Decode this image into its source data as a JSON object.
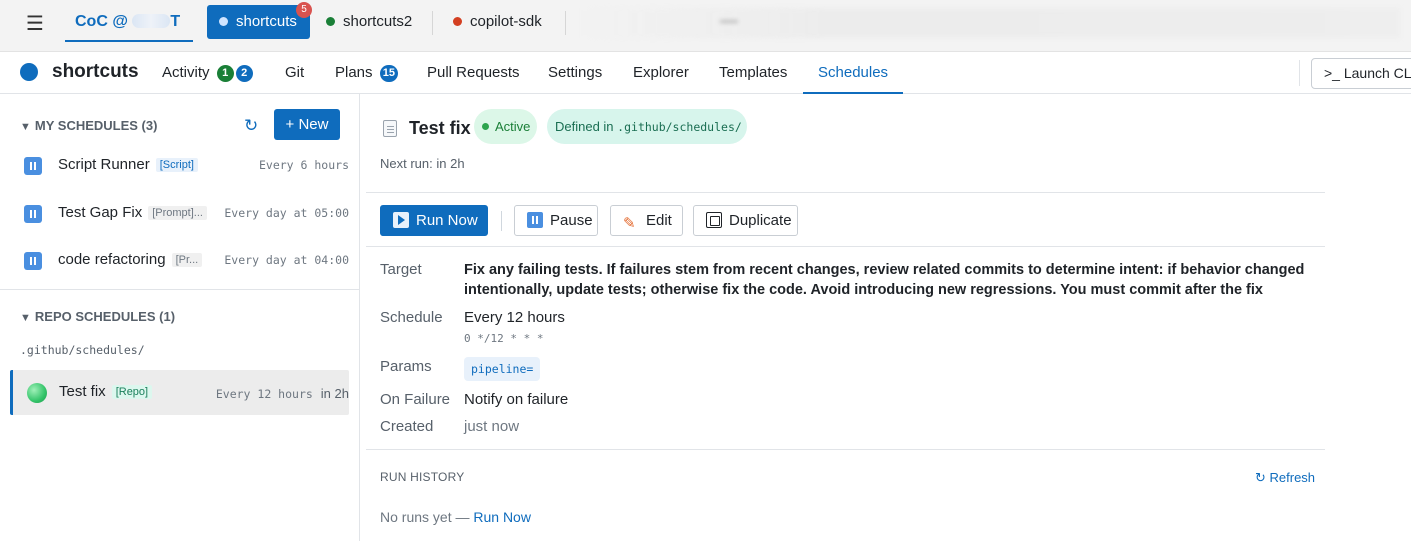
{
  "topbar": {
    "workspace_label": "CoC @",
    "workspace_suffix": "T",
    "tabs": [
      {
        "label": "shortcuts",
        "badge": "5",
        "dot_color": "#9ec9ff"
      },
      {
        "label": "shortcuts2",
        "dot_color": "#1a7f37"
      },
      {
        "label": "copilot-sdk",
        "dot_color": "#d33f21"
      }
    ]
  },
  "nav": {
    "repo_name": "shortcuts",
    "items": {
      "activity": "Activity",
      "activity_count_a": "1",
      "activity_count_b": "2",
      "git": "Git",
      "plans": "Plans",
      "plans_count": "15",
      "pull_requests": "Pull Requests",
      "settings": "Settings",
      "explorer": "Explorer",
      "templates": "Templates",
      "schedules": "Schedules"
    },
    "launch": ">_ Launch CLI"
  },
  "sidebar": {
    "my_schedules": "MY SCHEDULES (3)",
    "new_button": "+ New",
    "items": [
      {
        "name": "Script Runner",
        "tag": "[Script]",
        "when": "Every 6 hours"
      },
      {
        "name": "Test Gap Fix",
        "tag": "[Prompt]...",
        "when": "Every day at 05:00"
      },
      {
        "name": "code refactoring",
        "tag": "[Pr...",
        "when": "Every day at 04:00"
      }
    ],
    "repo_schedules": "REPO SCHEDULES (1)",
    "repo_path": ".github/schedules/",
    "repo_item": {
      "name": "Test fix",
      "tag": "[Repo]",
      "when": "Every 12 hours",
      "next": "in 2h"
    }
  },
  "detail": {
    "title": "Test fix",
    "status": "Active",
    "defined_prefix": "Defined in",
    "defined_path": ".github/schedules/",
    "next_run": "Next run: in 2h",
    "buttons": {
      "run_now": "Run Now",
      "pause": "Pause",
      "edit": "Edit",
      "duplicate": "Duplicate"
    },
    "labels": {
      "target": "Target",
      "schedule": "Schedule",
      "params": "Params",
      "on_failure": "On Failure",
      "created": "Created"
    },
    "target": "Fix any failing tests. If failures stem from recent changes, review related commits to determine intent: if behavior changed intentionally, update tests; otherwise fix the code. Avoid introducing new regressions. You must commit after the fix",
    "schedule": "Every 12 hours",
    "cron": "0 */12 * * *",
    "param": "pipeline=",
    "on_failure": "Notify on failure",
    "created": "just now",
    "history_title": "RUN HISTORY",
    "refresh": "↻ Refresh",
    "no_runs": "No runs yet —",
    "no_runs_link": "Run Now"
  },
  "colors": {
    "accent": "#0f6cbd",
    "activity_green": "#1a7f37",
    "activity_blue": "#0f6cbd",
    "badge_red": "#d9534f"
  }
}
